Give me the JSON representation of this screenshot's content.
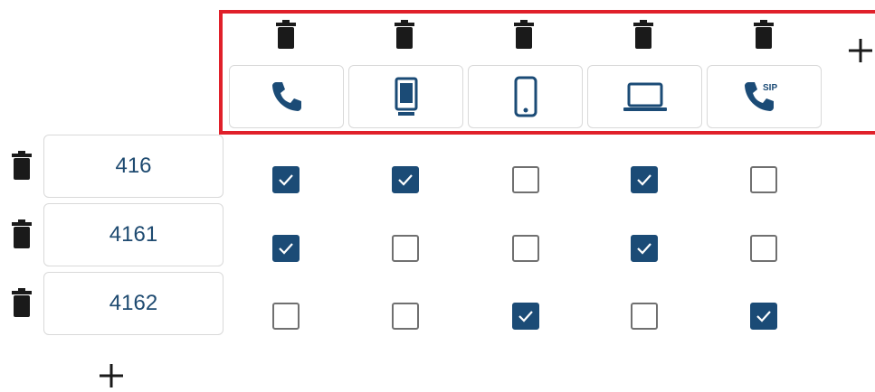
{
  "devices": [
    {
      "name": "phone-icon",
      "label_icon": "handset"
    },
    {
      "name": "desk-phone-icon",
      "label_icon": "desk-phone"
    },
    {
      "name": "mobile-icon",
      "label_icon": "mobile"
    },
    {
      "name": "laptop-icon",
      "label_icon": "laptop"
    },
    {
      "name": "sip-phone-icon",
      "label_icon": "sip",
      "badge": "SIP"
    }
  ],
  "numbers": [
    {
      "value": "416",
      "checks": [
        true,
        true,
        false,
        true,
        false
      ]
    },
    {
      "value": "4161",
      "checks": [
        true,
        false,
        false,
        true,
        false
      ]
    },
    {
      "value": "4162",
      "checks": [
        false,
        false,
        true,
        false,
        true
      ]
    }
  ],
  "add_column_label": "+",
  "add_row_label": "+",
  "colors": {
    "accent": "#1b4b76",
    "highlight": "#e0202a",
    "text": "#1e4a70",
    "icon_dark": "#1a1a1a"
  }
}
